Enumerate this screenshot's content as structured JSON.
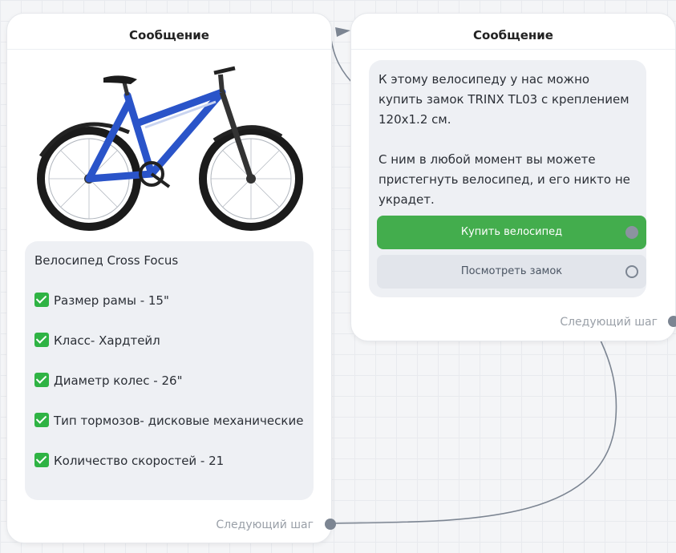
{
  "colors": {
    "accent_green": "#43ad4d",
    "check_green": "#2fb344",
    "connector": "#7c8592",
    "bike_blue": "#2a54c9"
  },
  "card1": {
    "title": "Сообщение",
    "image_alt": "bicycle-illustration",
    "lines": [
      "Велосипед Cross Focus",
      "Размер рамы - 15\"",
      "Класс- Хардтейл",
      "Диаметр колес - 26\"",
      "Тип тормозов- дисковые механические",
      "Количество скоростей - 21"
    ],
    "next_step": "Следующий шаг"
  },
  "card2": {
    "title": "Сообщение",
    "paragraph1": "К этому велосипеду у нас можно купить замок TRINX TL03 с креплением 120x1.2 см.",
    "paragraph2": "С ним в любой момент вы можете пристегнуть велосипед, и его никто не украдет.",
    "buttons": [
      {
        "label": "Купить велосипед"
      },
      {
        "label": "Посмотреть замок"
      }
    ],
    "next_step": "Следующий шаг"
  }
}
